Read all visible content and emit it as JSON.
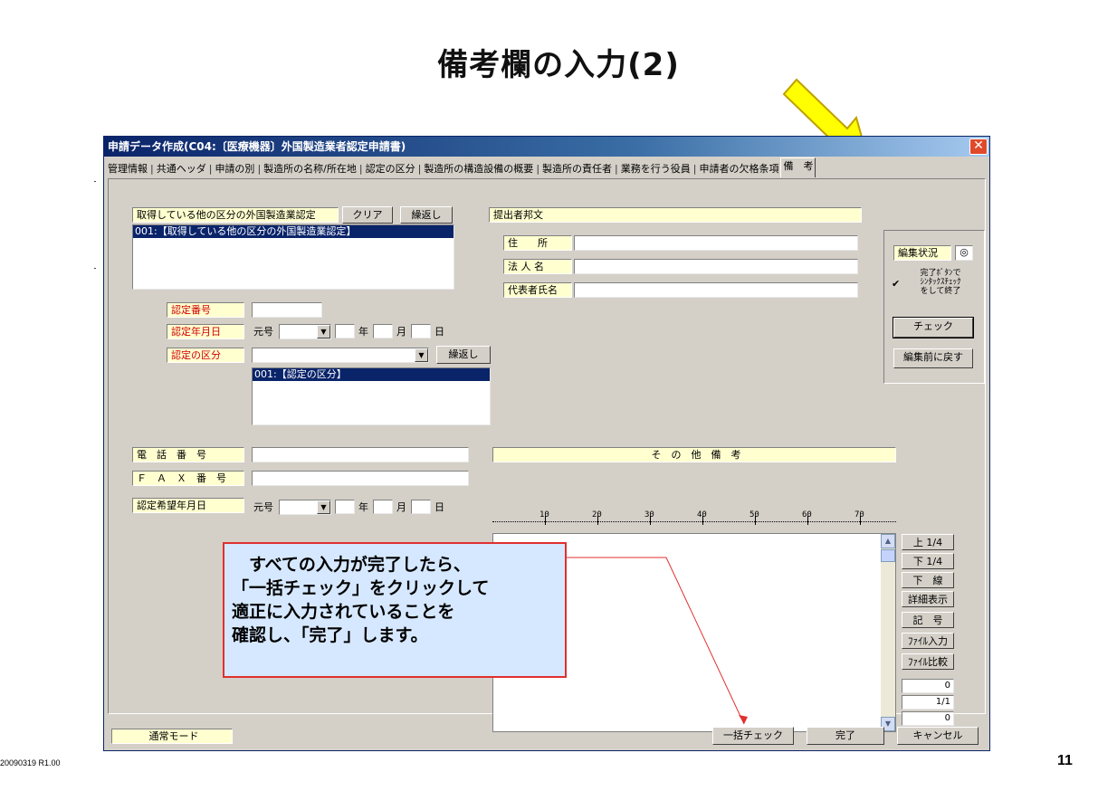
{
  "slide": {
    "title": "備考欄の入力(2)",
    "footer_code": "20090319 R1.00",
    "page_number": "11"
  },
  "window": {
    "title": "申請データ作成(C04:〔医療機器〕外国製造業者認定申請書)",
    "close_symbol": "✕"
  },
  "tabs": [
    {
      "label": "管理情報"
    },
    {
      "label": "共通ヘッダ"
    },
    {
      "label": "申請の別"
    },
    {
      "label": "製造所の名称/所在地"
    },
    {
      "label": "認定の区分"
    },
    {
      "label": "製造所の構造設備の概要"
    },
    {
      "label": "製造所の責任者"
    },
    {
      "label": "業務を行う役員"
    },
    {
      "label": "申請者の欠格条項"
    },
    {
      "label": "備　考",
      "active": true
    }
  ],
  "other_cert": {
    "label": "取得している他の区分の外国製造業認定",
    "clear_button": "クリア",
    "repeat_button": "繰返し",
    "list_item": "001:【取得している他の区分の外国製造業認定】"
  },
  "cert": {
    "number_label": "認定番号",
    "date_label": "認定年月日",
    "era_label": "元号",
    "year": "年",
    "month": "月",
    "day": "日",
    "category_label": "認定の区分",
    "repeat_button": "繰返し",
    "list_item": "001:【認定の区分】"
  },
  "submitter": {
    "header": "提出者邦文",
    "address_label": "住　　所",
    "corp_label": "法 人 名",
    "rep_label": "代表者氏名"
  },
  "contact": {
    "phone_label": "電　話　番　号",
    "fax_label": "Ｆ　Ａ　Ｘ　番　号",
    "desired_date_label": "認定希望年月日",
    "era_label": "元号",
    "year": "年",
    "month": "月",
    "day": "日"
  },
  "remarks": {
    "header": "そ　の　他　備　考",
    "ruler_marks": [
      "10",
      "20",
      "30",
      "40",
      "50",
      "60",
      "70"
    ]
  },
  "side_buttons": {
    "up": "上 1/4",
    "down": "下 1/4",
    "underline": "下　線",
    "detail": "詳細表示",
    "symbol": "記　号",
    "file_input": "ﾌｧｲﾙ入力",
    "file_compare": "ﾌｧｲﾙ比較",
    "counter1": "0",
    "counter2": "1/1",
    "counter3": "0"
  },
  "edit_panel": {
    "status_label": "編集状況",
    "status_mark": "◎",
    "checkbox_mark": "✔",
    "checkbox_text": [
      "完了ﾎﾞﾀﾝで",
      "ｼﾝﾀｯｸｽﾁｪｯｸ",
      "をして終了"
    ],
    "check_button": "チェック",
    "revert_button": "編集前に戻す"
  },
  "bottom": {
    "mode": "通常モード",
    "bulk_check": "一括チェック",
    "done": "完了",
    "cancel": "キャンセル"
  },
  "callout": {
    "lines": [
      "　すべての入力が完了したら、",
      "「一括チェック」をクリックして",
      "適正に入力されていることを",
      "確認し、「完了」します。"
    ]
  },
  "colors": {
    "arrow": "#ffff00",
    "callout_border": "#e03030",
    "callout_bg": "#d6e8ff",
    "label_bg": "#ffffd0",
    "selection": "#0a246a"
  }
}
